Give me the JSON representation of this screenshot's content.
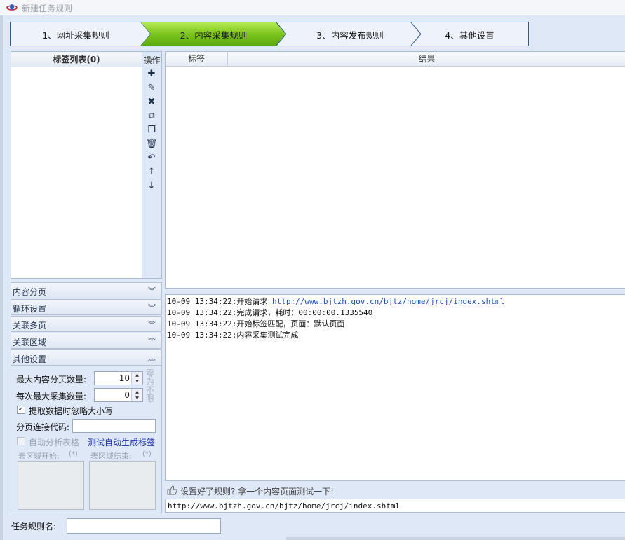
{
  "window": {
    "title": "新建任务规则"
  },
  "wizard": {
    "steps": [
      {
        "label": "1、网址采集规则",
        "active": false
      },
      {
        "label": "2、内容采集规则",
        "active": true
      },
      {
        "label": "3、内容发布规则",
        "active": false
      },
      {
        "label": "4、其他设置",
        "active": false
      }
    ]
  },
  "tag_list": {
    "header": "标签列表(0)"
  },
  "ops": {
    "title": "操作",
    "buttons": [
      {
        "name": "add-icon",
        "glyph": "✚"
      },
      {
        "name": "edit-icon",
        "glyph": "✎"
      },
      {
        "name": "delete-icon",
        "glyph": "✖"
      },
      {
        "name": "copy-icon",
        "glyph": "⧉"
      },
      {
        "name": "paste-icon",
        "glyph": "❐"
      },
      {
        "name": "trash-icon",
        "glyph": "🗑"
      },
      {
        "name": "undo-icon",
        "glyph": "↶"
      },
      {
        "name": "move-up-icon",
        "glyph": "↑"
      },
      {
        "name": "move-down-icon",
        "glyph": "↓"
      }
    ]
  },
  "grid": {
    "col_tag": "标签",
    "col_result": "结果"
  },
  "log": {
    "lines": [
      {
        "time": "10-09 13:34:22:",
        "text": "开始请求 ",
        "link": "http://www.bjtzh.gov.cn/bjtz/home/jrcj/index.shtml"
      },
      {
        "time": "10-09 13:34:22:",
        "text": "完成请求，耗时：00:00:00.1335540",
        "link": ""
      },
      {
        "time": "10-09 13:34:22:",
        "text": "开始标签匹配，页面：默认页面",
        "link": ""
      },
      {
        "time": "10-09 13:34:22:",
        "text": "内容采集测试完成",
        "link": ""
      }
    ]
  },
  "test_bar": {
    "text": "设置好了规则? 拿一个内容页面测试一下!"
  },
  "test_url": {
    "value": "http://www.bjtzh.gov.cn/bjtz/home/jrcj/index.shtml"
  },
  "accordion": {
    "items": [
      "内容分页",
      "循环设置",
      "关联多页",
      "关联区域",
      "其他设置"
    ]
  },
  "other_settings": {
    "max_pages_label": "最大内容分页数量:",
    "max_pages_value": "10",
    "max_collect_label": "每次最大采集数量:",
    "max_collect_value": "0",
    "zero_note": "零为不限",
    "ignore_case_label": "提取数据时忽略大小写",
    "ignore_case_checked": "✓",
    "page_link_label": "分页连接代码:",
    "auto_table_label": "自动分析表格",
    "auto_tag_link": "测试自动生成标签",
    "table_start_label": "表区域开始:",
    "table_end_label": "表区域结束:",
    "wildcard": "(*)"
  },
  "footer": {
    "rule_name_label": "任务规则名:"
  },
  "colors": {
    "active_step": "#7cc51d",
    "accent_blue": "#2f5b9a"
  }
}
